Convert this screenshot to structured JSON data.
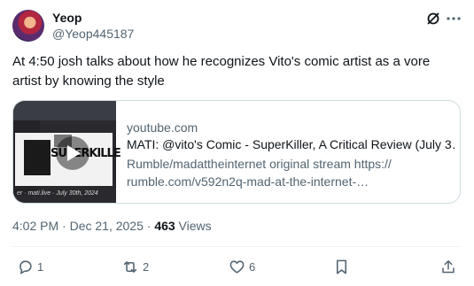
{
  "tweet": {
    "display_name": "Yeop",
    "handle": "@Yeop445187",
    "text": "At 4:50 josh talks about how he recognizes Vito's comic artist as a vore artist by knowing the style",
    "timestamp": "4:02 PM · Dec 21, 2025 · ",
    "views_count": "463",
    "views_label": " Views"
  },
  "card": {
    "domain": "youtube.com",
    "title": "MATI: @vito's Comic - SuperKiller, A Critical Review (July 3…",
    "description": "Rumble/madattheinternet original stream https:// rumble.com/v592n2q-mad-at-the-internet-…",
    "thumbnail_title": "SUPERKILLE",
    "thumbnail_footer": "er · mati.live · July 30th, 2024"
  },
  "actions": {
    "reply_count": "1",
    "retweet_count": "2",
    "like_count": "6"
  },
  "icons": [
    "grok-icon",
    "more-icon",
    "reply-icon",
    "retweet-icon",
    "like-icon",
    "bookmark-icon",
    "share-icon",
    "play-icon"
  ],
  "colors": {
    "text": "#0f1419",
    "secondary": "#536471",
    "border": "#cfd9de"
  }
}
